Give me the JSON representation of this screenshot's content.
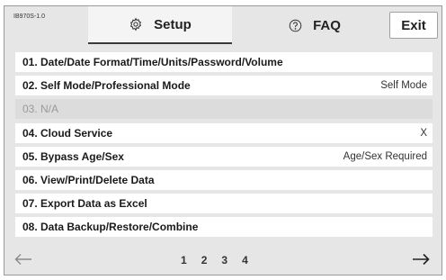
{
  "header": {
    "version": "IB970S-1.0",
    "tabs": [
      {
        "label": "Setup",
        "icon": "gear-icon",
        "active": true
      },
      {
        "label": "FAQ",
        "icon": "help-icon",
        "active": false
      }
    ],
    "exit_label": "Exit"
  },
  "menu": {
    "items": [
      {
        "label": "01. Date/Date Format/Time/Units/Password/Volume",
        "value": ""
      },
      {
        "label": "02. Self Mode/Professional Mode",
        "value": "Self Mode"
      },
      {
        "label": "03. N/A",
        "value": "",
        "disabled": true
      },
      {
        "label": "04. Cloud Service",
        "value": "X"
      },
      {
        "label": "05. Bypass Age/Sex",
        "value": "Age/Sex Required"
      },
      {
        "label": "06. View/Print/Delete Data",
        "value": ""
      },
      {
        "label": "07. Export Data as Excel",
        "value": ""
      },
      {
        "label": "08. Data Backup/Restore/Combine",
        "value": ""
      }
    ]
  },
  "footer": {
    "pages": [
      "1",
      "2",
      "3",
      "4"
    ],
    "prev_icon": "arrow-left-icon",
    "next_icon": "arrow-right-icon"
  }
}
